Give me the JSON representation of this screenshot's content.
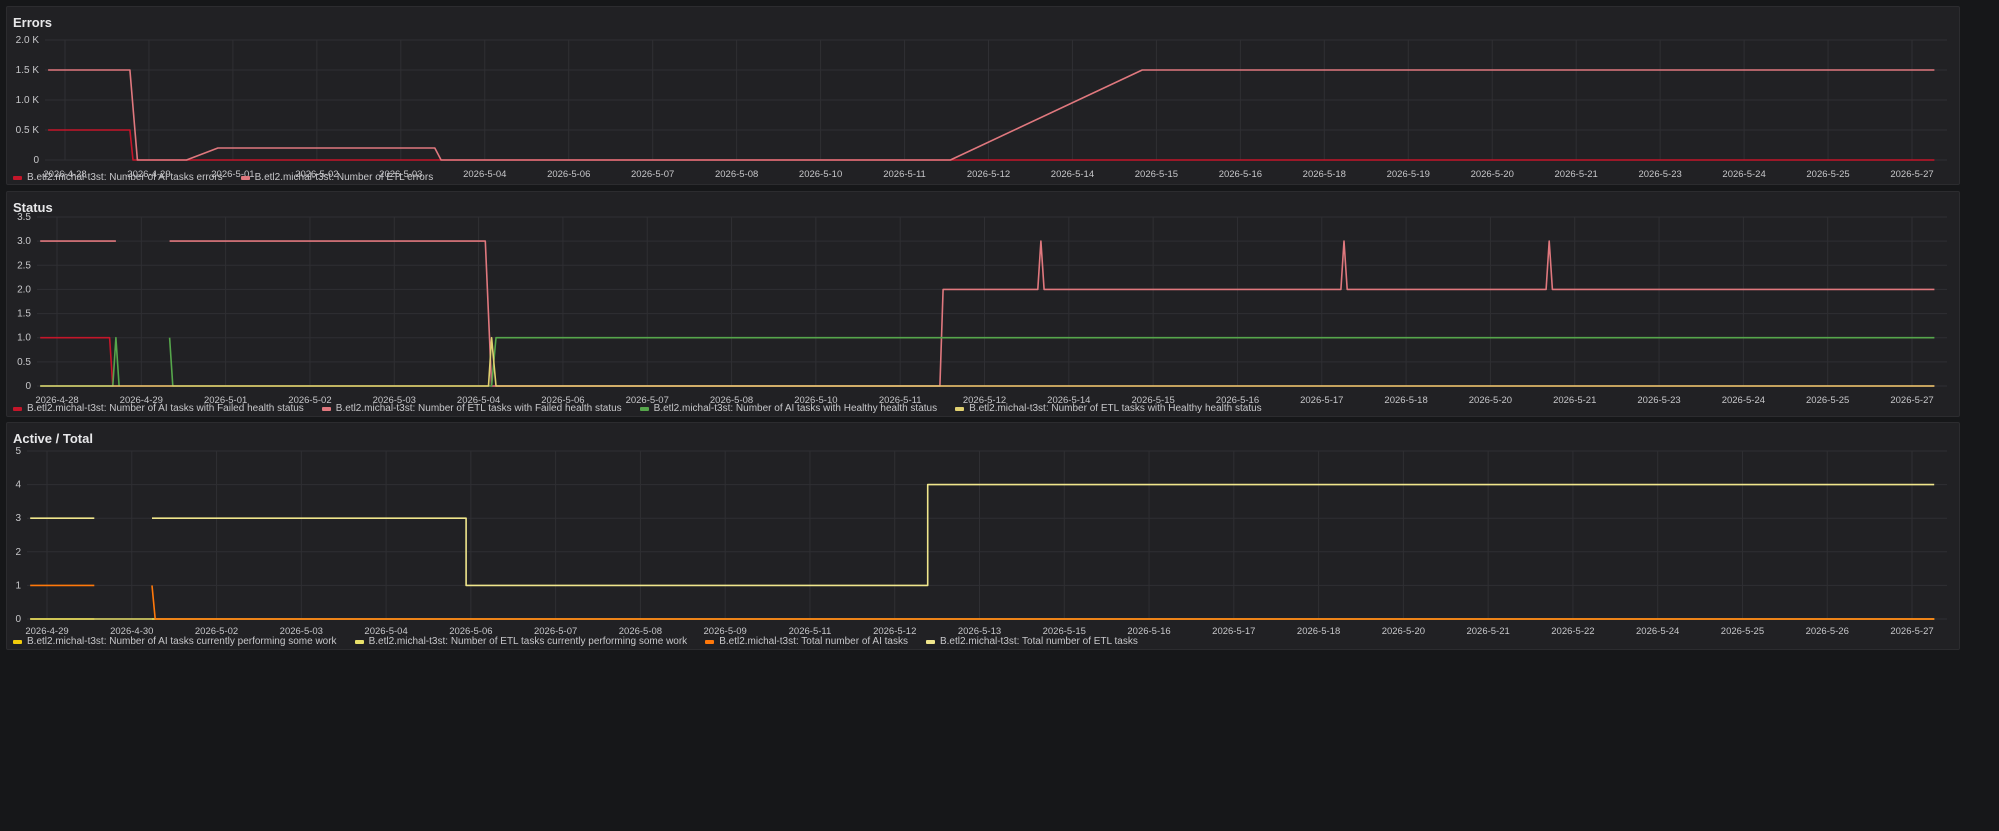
{
  "chart_data": [
    {
      "type": "line",
      "title": "Errors",
      "ylim": [
        0,
        2000
      ],
      "yticks": [
        {
          "value": 0,
          "label": "0"
        },
        {
          "value": 500,
          "label": "0.5 K"
        },
        {
          "value": 1000,
          "label": "1.0 K"
        },
        {
          "value": 1500,
          "label": "1.5 K"
        },
        {
          "value": 2000,
          "label": "2.0 K"
        }
      ],
      "x_range_days": [
        -0.05,
        30.2
      ],
      "x_ticks": [
        "2026-4-28",
        "2026-4-29",
        "2026-5-01",
        "2026-5-02",
        "2026-5-03",
        "2026-5-04",
        "2026-5-06",
        "2026-5-07",
        "2026-5-08",
        "2026-5-10",
        "2026-5-11",
        "2026-5-12",
        "2026-5-14",
        "2026-5-15",
        "2026-5-16",
        "2026-5-18",
        "2026-5-19",
        "2026-5-20",
        "2026-5-21",
        "2026-5-23",
        "2026-5-24",
        "2026-5-25",
        "2026-5-27"
      ],
      "legend_placement": "bottom",
      "grid": true,
      "series": [
        {
          "name": "B.etl2.michal-t3st: Number of AI tasks errors",
          "color": "#c4162a",
          "points": [
            [
              0,
              500
            ],
            [
              1.3,
              500
            ],
            [
              1.35,
              0
            ],
            [
              30,
              0
            ]
          ]
        },
        {
          "name": "B.etl2.michal-t3st: Number of ETL errors",
          "color": "#e0787e",
          "points": [
            [
              0,
              1500
            ],
            [
              1.3,
              1500
            ],
            [
              1.42,
              0
            ],
            [
              2.2,
              0
            ],
            [
              2.7,
              200
            ],
            [
              6.15,
              200
            ],
            [
              6.25,
              0
            ],
            [
              14.35,
              0
            ],
            [
              17.4,
              1500
            ],
            [
              30,
              1500
            ]
          ]
        }
      ]
    },
    {
      "type": "line",
      "title": "Status",
      "ylim": [
        0,
        3.5
      ],
      "yticks": [
        {
          "value": 0,
          "label": "0"
        },
        {
          "value": 0.5,
          "label": "0.5"
        },
        {
          "value": 1,
          "label": "1.0"
        },
        {
          "value": 1.5,
          "label": "1.5"
        },
        {
          "value": 2,
          "label": "2.0"
        },
        {
          "value": 2.5,
          "label": "2.5"
        },
        {
          "value": 3,
          "label": "3.0"
        },
        {
          "value": 3.5,
          "label": "3.5"
        }
      ],
      "x_range_days": [
        -0.05,
        30.2
      ],
      "x_ticks": [
        "2026-4-28",
        "2026-4-29",
        "2026-5-01",
        "2026-5-02",
        "2026-5-03",
        "2026-5-04",
        "2026-5-06",
        "2026-5-07",
        "2026-5-08",
        "2026-5-10",
        "2026-5-11",
        "2026-5-12",
        "2026-5-14",
        "2026-5-15",
        "2026-5-16",
        "2026-5-17",
        "2026-5-18",
        "2026-5-20",
        "2026-5-21",
        "2026-5-23",
        "2026-5-24",
        "2026-5-25",
        "2026-5-27"
      ],
      "legend_placement": "bottom",
      "grid": true,
      "series": [
        {
          "name": "B.etl2.michal-t3st: Number of AI tasks with Failed health status",
          "color": "#c4162a",
          "points": [
            [
              0,
              1
            ],
            [
              1.1,
              1
            ],
            [
              1.15,
              0
            ],
            [
              30,
              0
            ]
          ]
        },
        {
          "name": "B.etl2.michal-t3st: Number of ETL tasks with Failed health status",
          "color": "#e0787e",
          "points": [
            [
              0,
              3
            ],
            [
              1.2,
              3
            ],
            null,
            [
              2.05,
              3
            ],
            [
              7.05,
              3
            ],
            [
              7.15,
              0
            ],
            [
              14.25,
              0
            ],
            [
              14.3,
              2
            ],
            [
              15.8,
              2
            ],
            [
              15.85,
              3
            ],
            [
              15.9,
              2
            ],
            [
              20.6,
              2
            ],
            [
              20.65,
              3
            ],
            [
              20.7,
              2
            ],
            [
              23.85,
              2
            ],
            [
              23.9,
              3
            ],
            [
              23.95,
              2
            ],
            [
              30,
              2
            ]
          ]
        },
        {
          "name": "B.etl2.michal-t3st: Number of AI tasks with Healthy health status",
          "color": "#56a64b",
          "points": [
            [
              0,
              0
            ],
            [
              1.15,
              0
            ],
            [
              1.2,
              1
            ],
            [
              1.25,
              0
            ],
            null,
            [
              2.05,
              1
            ],
            [
              2.1,
              0
            ],
            [
              7.15,
              0
            ],
            [
              7.22,
              1
            ],
            [
              30,
              1
            ]
          ]
        },
        {
          "name": "B.etl2.michal-t3st: Number of ETL tasks with Healthy health status",
          "color": "#e0d071",
          "points": [
            [
              0,
              0
            ],
            [
              7.1,
              0
            ],
            [
              7.15,
              1
            ],
            [
              7.22,
              0
            ],
            [
              30,
              0
            ]
          ]
        }
      ]
    },
    {
      "type": "line",
      "title": "Active / Total",
      "ylim": [
        0,
        5
      ],
      "yticks": [
        {
          "value": 0,
          "label": "0"
        },
        {
          "value": 1,
          "label": "1"
        },
        {
          "value": 2,
          "label": "2"
        },
        {
          "value": 3,
          "label": "3"
        },
        {
          "value": 4,
          "label": "4"
        },
        {
          "value": 5,
          "label": "5"
        }
      ],
      "x_range_days": [
        -0.05,
        29.9
      ],
      "x_ticks": [
        "2026-4-29",
        "2026-4-30",
        "2026-5-02",
        "2026-5-03",
        "2026-5-04",
        "2026-5-06",
        "2026-5-07",
        "2026-5-08",
        "2026-5-09",
        "2026-5-11",
        "2026-5-12",
        "2026-5-13",
        "2026-5-15",
        "2026-5-16",
        "2026-5-17",
        "2026-5-18",
        "2026-5-20",
        "2026-5-21",
        "2026-5-22",
        "2026-5-24",
        "2026-5-25",
        "2026-5-26",
        "2026-5-27"
      ],
      "legend_placement": "bottom",
      "grid": true,
      "series": [
        {
          "name": "B.etl2.michal-t3st: Number of AI tasks currently performing some work",
          "color": "#f2cc0c",
          "points": [
            [
              0,
              0
            ],
            [
              1,
              0
            ],
            null,
            [
              1.9,
              0
            ],
            [
              29.7,
              0
            ]
          ]
        },
        {
          "name": "B.etl2.michal-t3st: Number of ETL tasks currently performing some work",
          "color": "#e8e06a",
          "points": [
            [
              0,
              0
            ],
            [
              29.7,
              0
            ]
          ]
        },
        {
          "name": "B.etl2.michal-t3st: Total number of AI tasks",
          "color": "#ff780a",
          "points": [
            [
              0,
              1
            ],
            [
              1,
              1
            ],
            null,
            [
              1.9,
              1
            ],
            [
              1.95,
              0
            ],
            [
              29.7,
              0
            ]
          ]
        },
        {
          "name": "B.etl2.michal-t3st: Total number of ETL tasks",
          "color": "#f0e68c",
          "points": [
            [
              0,
              3
            ],
            [
              1,
              3
            ],
            null,
            [
              1.9,
              3
            ],
            [
              6.8,
              3
            ],
            [
              6.8,
              1
            ],
            [
              14,
              1
            ],
            [
              14,
              4
            ],
            [
              29.7,
              4
            ]
          ]
        }
      ]
    }
  ]
}
